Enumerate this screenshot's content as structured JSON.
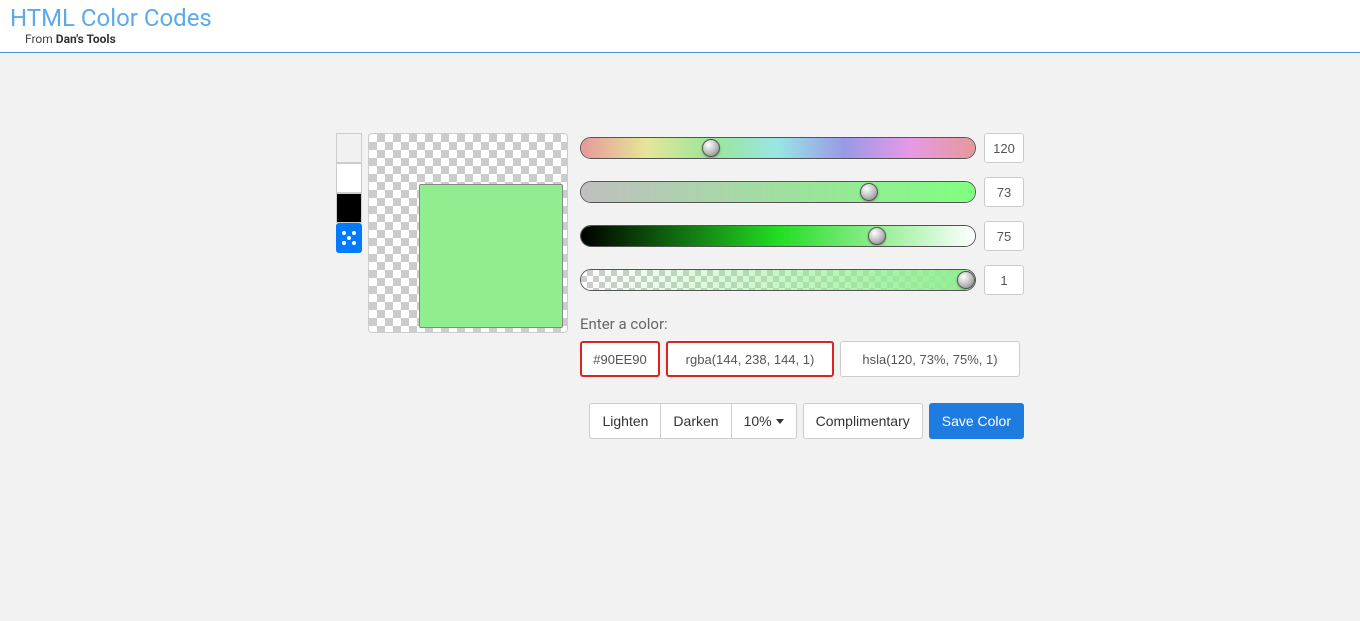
{
  "header": {
    "title": "HTML Color Codes",
    "from": "From ",
    "tool": "Dan's Tools"
  },
  "preview": {
    "color": "#90EE90"
  },
  "history": {
    "items": [
      "#f1f1f1",
      "#ffffff",
      "#000000"
    ]
  },
  "sliders": {
    "hue": {
      "value": "120",
      "pos": 33
    },
    "sat": {
      "value": "73",
      "pos": 73
    },
    "light": {
      "value": "75",
      "pos": 75
    },
    "alpha": {
      "value": "1",
      "pos": 100
    }
  },
  "enter": {
    "label": "Enter a color:",
    "hex": "#90EE90",
    "rgba": "rgba(144, 238, 144, 1)",
    "hsla": "hsla(120, 73%, 75%, 1)"
  },
  "actions": {
    "lighten": "Lighten",
    "darken": "Darken",
    "step": "10% ",
    "complimentary": "Complimentary",
    "save": "Save Color"
  }
}
